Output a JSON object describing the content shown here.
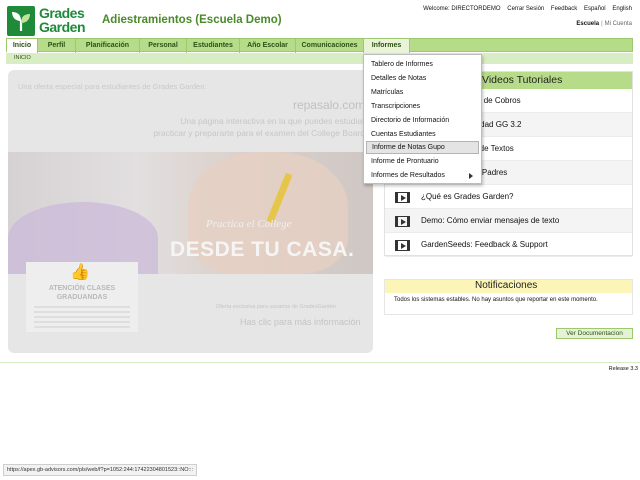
{
  "app": {
    "logo_line1": "Grades",
    "logo_line2": "Garden",
    "title": "Adiestramientos (Escuela Demo)"
  },
  "top_links": {
    "welcome": "Welcome: DIRECTORDEMO",
    "logout": "Cerrar Sesión",
    "feedback": "Feedback",
    "spanish": "Español",
    "english": "English"
  },
  "sub_links": {
    "school": "Escuela",
    "separator": "|",
    "account": "Mi Cuenta"
  },
  "nav": {
    "items": [
      {
        "label": "Inicio"
      },
      {
        "label": "Perfil"
      },
      {
        "label": "Planificación"
      },
      {
        "label": "Personal"
      },
      {
        "label": "Estudiantes"
      },
      {
        "label": "Año Escolar"
      },
      {
        "label": "Comunicaciones"
      },
      {
        "label": "Informes"
      }
    ],
    "breadcrumb": "INICIO"
  },
  "reports_menu": {
    "items": [
      {
        "label": "Tablero de Informes"
      },
      {
        "label": "Detalles de Notas"
      },
      {
        "label": "Matrículas"
      },
      {
        "label": "Transcripciones"
      },
      {
        "label": "Directorio de Información"
      },
      {
        "label": "Cuentas Estudiantes"
      },
      {
        "label": "Informe de Notas Gupo"
      },
      {
        "label": "Informe de Prontuario"
      },
      {
        "label": "Informes de Resultados"
      }
    ]
  },
  "promo": {
    "headline": "Una oferta especial para estudiantes de Grades Garden:",
    "brand": "repasalo.com",
    "line1": "Una página interactiva en la que puedes estudiar",
    "line2": "practicar y prepararte para el examen del College Board",
    "script": "Practica el College",
    "big": "DESDE TU CASA.",
    "grad_title": "ATENCIÓN CLASES GRADUANDAS",
    "small": "Oferta exclusiva para usuarios de GradesGarden",
    "link": "Has clic para más información"
  },
  "videos": {
    "title": "Videos Tutoriales",
    "items": [
      {
        "label": "Seminario Jardín de Cobros"
      },
      {
        "label": "Nueva funcionalidad GG 3.2"
      },
      {
        "label": "Usar el Sistema de Textos"
      },
      {
        "label": "Redes Jardín de Padres"
      },
      {
        "label": "¿Qué es Grades Garden?"
      },
      {
        "label": "Demo: Cómo enviar mensajes de texto"
      },
      {
        "label": "GardenSeeds: Feedback & Support"
      }
    ]
  },
  "notifications": {
    "title": "Notificaciones",
    "text": "Todos los sistemas estables. No hay asuntos que reportar en este momento."
  },
  "doc_button": "Ver Documentacion",
  "release": "Release 3.3",
  "status_url": "https://apex.gb-advisors.com/pls/web/f?p=1052:244:17422304801523::NO:::",
  "colors": {
    "nav_green": "#b6dc8a",
    "brand_green": "#1f8a3a",
    "notif_yellow": "#fbf6b8"
  }
}
